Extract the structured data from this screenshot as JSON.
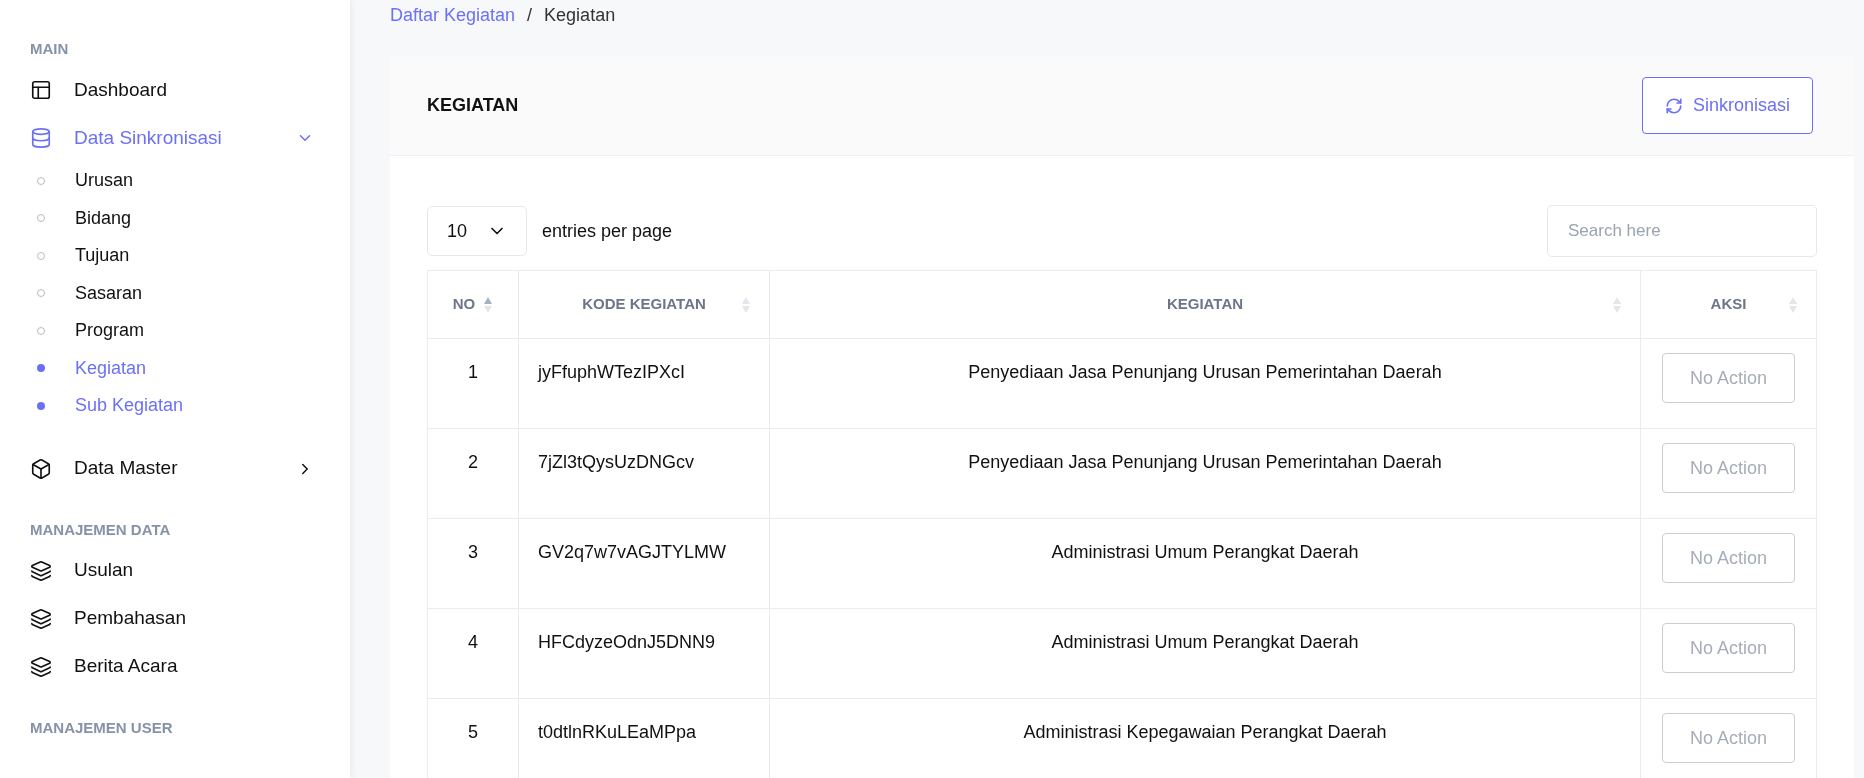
{
  "sidebar": {
    "sections": [
      {
        "title": "MAIN",
        "items": [
          {
            "label": "Dashboard",
            "kind": "layout",
            "active": false
          },
          {
            "label": "Data Sinkronisasi",
            "kind": "database",
            "active": true,
            "expanded": true,
            "children": [
              {
                "label": "Urusan",
                "selected": false
              },
              {
                "label": "Bidang",
                "selected": false
              },
              {
                "label": "Tujuan",
                "selected": false
              },
              {
                "label": "Sasaran",
                "selected": false
              },
              {
                "label": "Program",
                "selected": false
              },
              {
                "label": "Kegiatan",
                "selected": true
              },
              {
                "label": "Sub Kegiatan",
                "selected": true
              }
            ]
          },
          {
            "label": "Data Master",
            "kind": "box",
            "active": false,
            "expanded": false
          }
        ]
      },
      {
        "title": "MANAJEMEN DATA",
        "items": [
          {
            "label": "Usulan",
            "kind": "layers",
            "active": false
          },
          {
            "label": "Pembahasan",
            "kind": "layers",
            "active": false
          },
          {
            "label": "Berita Acara",
            "kind": "layers",
            "active": false
          }
        ]
      },
      {
        "title": "MANAJEMEN USER"
      }
    ]
  },
  "breadcrumb": {
    "separator": "/",
    "items": [
      {
        "label": "Daftar Kegiatan",
        "link": true
      },
      {
        "label": "Kegiatan",
        "link": false
      }
    ]
  },
  "card": {
    "title": "KEGIATAN",
    "sync_button": "Sinkronisasi",
    "entries": {
      "value": "10",
      "label": "entries per page"
    },
    "search": {
      "placeholder": "Search here"
    },
    "table": {
      "columns": [
        {
          "label": "NO",
          "sorted": true
        },
        {
          "label": "KODE KEGIATAN",
          "sorted": false
        },
        {
          "label": "KEGIATAN",
          "sorted": false
        },
        {
          "label": "AKSI",
          "sorted": false
        }
      ],
      "rows": [
        {
          "no": "1",
          "kode": "jyFfuphWTezIPXcI",
          "kegiatan": "Penyediaan Jasa Penunjang Urusan Pemerintahan Daerah",
          "action": "No Action",
          "disabled": true
        },
        {
          "no": "2",
          "kode": "7jZl3tQysUzDNGcv",
          "kegiatan": "Penyediaan Jasa Penunjang Urusan Pemerintahan Daerah",
          "action": "No Action",
          "disabled": true
        },
        {
          "no": "3",
          "kode": "GV2q7w7vAGJTYLMW",
          "kegiatan": "Administrasi Umum Perangkat Daerah",
          "action": "No Action",
          "disabled": true
        },
        {
          "no": "4",
          "kode": "HFCdyzeOdnJ5DNN9",
          "kegiatan": "Administrasi Umum Perangkat Daerah",
          "action": "No Action",
          "disabled": true
        },
        {
          "no": "5",
          "kode": "t0dtlnRKuLEaMPpa",
          "kegiatan": "Administrasi Kepegawaian Perangkat Daerah",
          "action": "No Action",
          "disabled": true
        }
      ]
    }
  }
}
